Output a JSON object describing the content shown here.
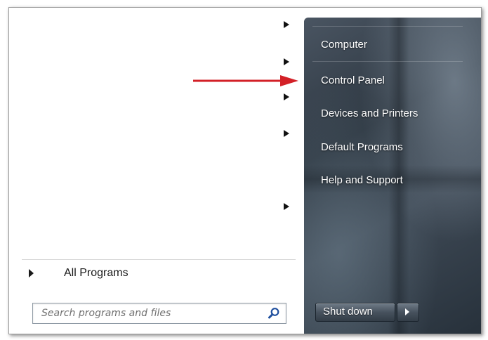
{
  "start_menu": {
    "all_programs_label": "All Programs",
    "search": {
      "placeholder": "Search programs and files",
      "icon": "search-icon"
    },
    "right_items": [
      {
        "label": "Computer"
      },
      {
        "label": "Control Panel"
      },
      {
        "label": "Devices and Printers"
      },
      {
        "label": "Default Programs"
      },
      {
        "label": "Help and Support"
      }
    ],
    "shutdown_label": "Shut down",
    "shutdown_options_icon": "chevron-right-icon"
  },
  "annotation": {
    "arrow_color": "#d32027",
    "points_to": "Control Panel"
  },
  "colors": {
    "right_pane": "#2f3944",
    "menu_text": "#ffffff",
    "left_text": "#1a1a1a"
  }
}
